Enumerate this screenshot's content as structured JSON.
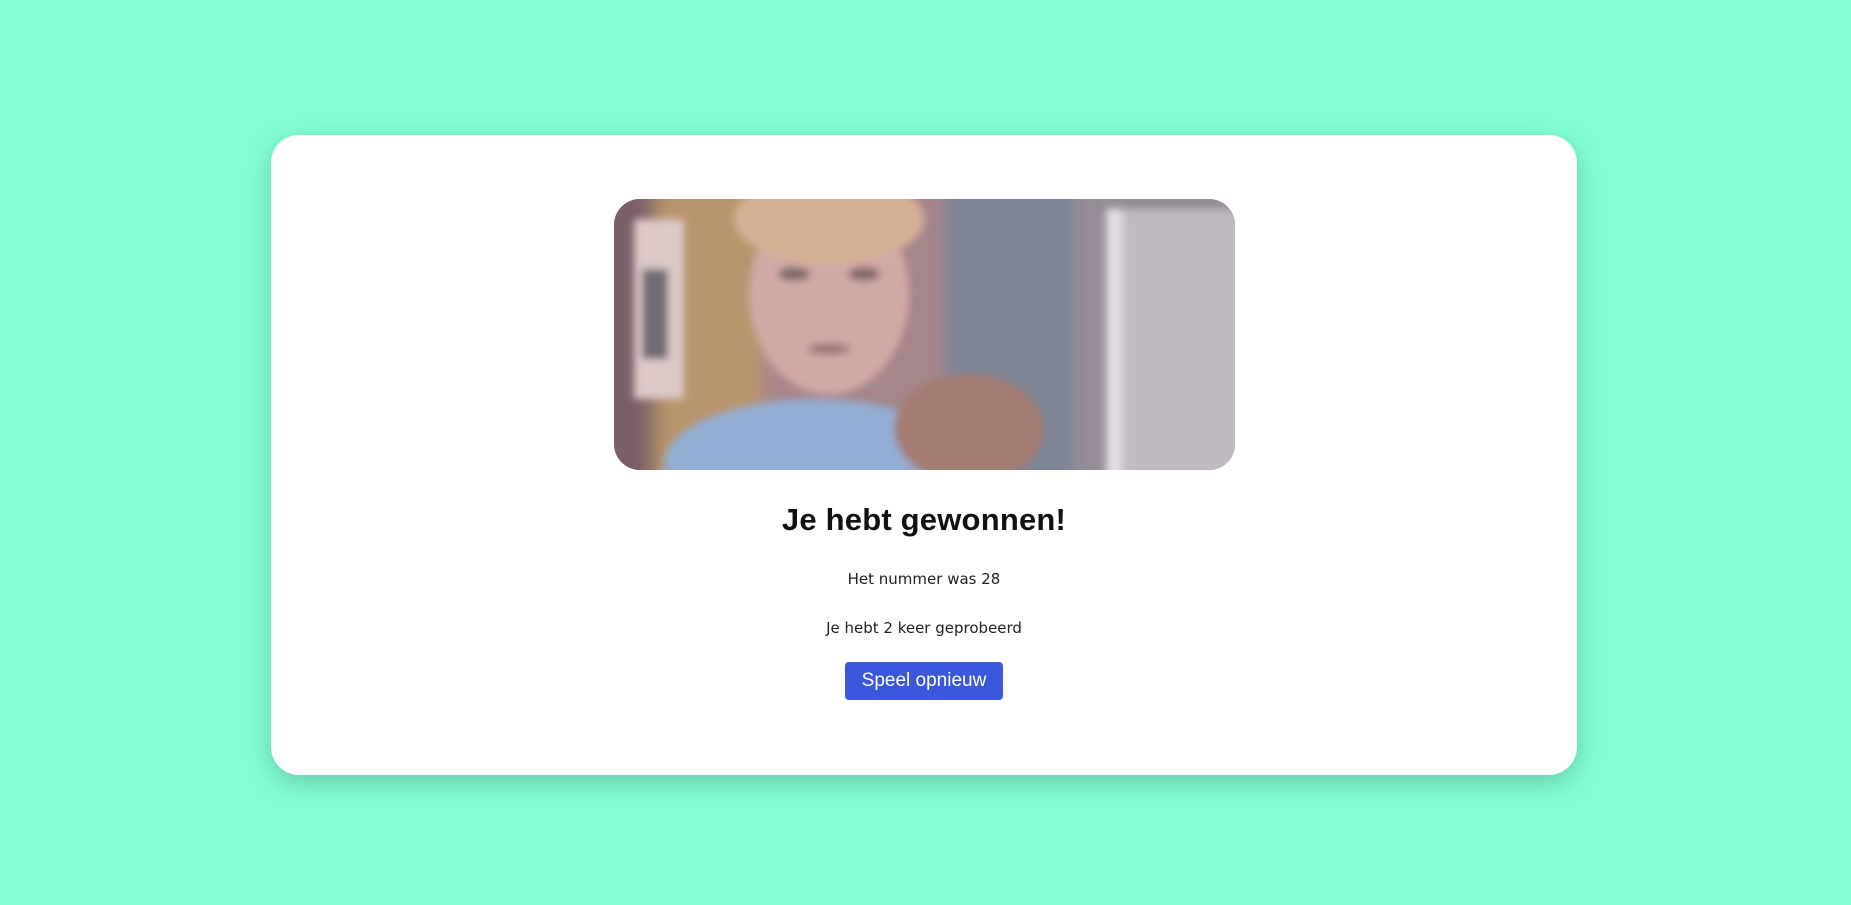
{
  "colors": {
    "background": "#84ffd5",
    "card": "#ffffff",
    "button": "#3a57dd",
    "button_text": "#ffffff"
  },
  "result": {
    "heading": "Je hebt gewonnen!",
    "number_text": "Het nummer was 28",
    "attempts_text": "Je hebt 2 keer geprobeerd"
  },
  "actions": {
    "play_again_label": "Speel opnieuw"
  },
  "media": {
    "icon": "celebration-gif"
  }
}
